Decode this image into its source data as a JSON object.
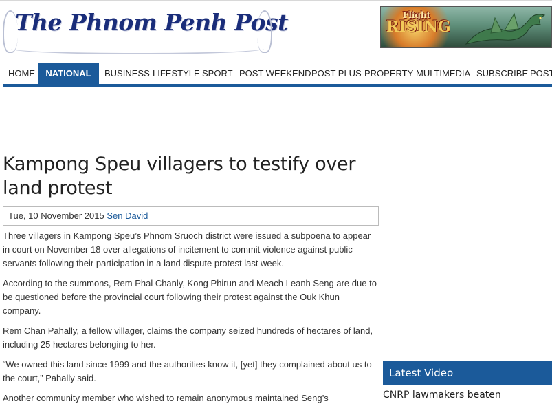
{
  "masthead": {
    "logo_text": "The Phnom Penh Post"
  },
  "ad": {
    "line1": "Flight",
    "line2": "RISING"
  },
  "nav": {
    "items": [
      {
        "label": "HOME"
      },
      {
        "label": "NATIONAL",
        "active": true
      },
      {
        "label": "BUSINESS"
      },
      {
        "label": "LIFESTYLE"
      },
      {
        "label": "SPORT"
      },
      {
        "label": "POST WEEKEND"
      },
      {
        "label": "POST PLUS"
      },
      {
        "label": "PROPERTY"
      },
      {
        "label": "MULTIMEDIA"
      },
      {
        "label": "SUBSCRIBE"
      },
      {
        "label": "POST"
      }
    ]
  },
  "article": {
    "headline": "Kampong Speu villagers to testify over land protest",
    "date": "Tue, 10 November 2015",
    "author": "Sen David",
    "paragraphs": [
      "Three villagers in Kampong Speu’s Phnom Sruoch district were issued a subpoena to appear in court on November 18 over allegations of incitement to commit violence against public servants following their participation in a land dispute protest last week.",
      "According to the summons, Rem Phal Chanly, Kong Phirun and Meach Leanh Seng are due to be questioned before the provincial court following their protest against the Ouk Khun company.",
      "Rem Chan Pahally, a fellow villager, claims the company seized hundreds of hectares of land, including 25 hectares belonging to her.",
      "“We owned this land since 1999 and the authorities know it, [yet] they complained about us to the court,” Pahally said.",
      "Another community member who wished to remain anonymous maintained Seng’s"
    ]
  },
  "sidebar": {
    "latest_video_heading": "Latest Video",
    "video_title": "CNRP lawmakers beaten"
  },
  "colors": {
    "brand_blue": "#1b5a9a",
    "logo_navy": "#1a2d7a"
  }
}
